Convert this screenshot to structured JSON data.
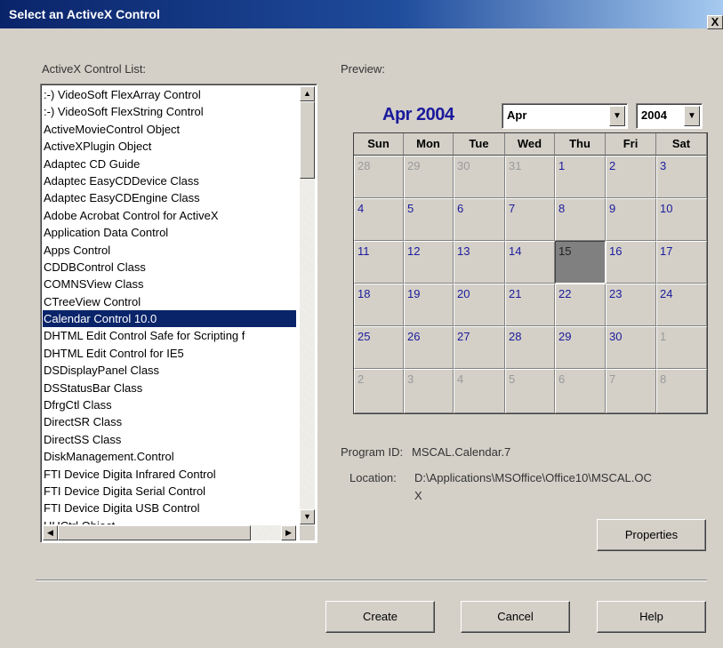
{
  "window": {
    "title": "Select an ActiveX Control",
    "close_label": "X"
  },
  "list": {
    "label": "ActiveX Control List:",
    "items": [
      ":-) VideoSoft FlexArray Control",
      ":-) VideoSoft FlexString Control",
      "ActiveMovieControl Object",
      "ActiveXPlugin Object",
      "Adaptec CD Guide",
      "Adaptec EasyCDDevice Class",
      "Adaptec EasyCDEngine Class",
      "Adobe Acrobat Control for ActiveX",
      "Application Data Control",
      "Apps Control",
      "CDDBControl Class",
      "COMNSView Class",
      "CTreeView Control",
      "Calendar Control 10.0",
      "DHTML Edit Control Safe for Scripting f",
      "DHTML Edit Control for IE5",
      "DSDisplayPanel Class",
      "DSStatusBar Class",
      "DfrgCtl Class",
      "DirectSR Class",
      "DirectSS Class",
      "DiskManagement.Control",
      "FTI Device Digita Infrared Control",
      "FTI Device Digita Serial Control",
      "FTI Device Digita USB Control",
      "HHCtrl Object"
    ],
    "selected_index": 13
  },
  "preview": {
    "label": "Preview:",
    "calendar_title": "Apr 2004",
    "month_value": "Apr",
    "year_value": "2004",
    "day_names": [
      "Sun",
      "Mon",
      "Tue",
      "Wed",
      "Thu",
      "Fri",
      "Sat"
    ],
    "weeks": [
      [
        "28",
        "29",
        "30",
        "31",
        "1",
        "2",
        "3"
      ],
      [
        "4",
        "5",
        "6",
        "7",
        "8",
        "9",
        "10"
      ],
      [
        "11",
        "12",
        "13",
        "14",
        "15",
        "16",
        "17"
      ],
      [
        "18",
        "19",
        "20",
        "21",
        "22",
        "23",
        "24"
      ],
      [
        "25",
        "26",
        "27",
        "28",
        "29",
        "30",
        "1"
      ],
      [
        "2",
        "3",
        "4",
        "5",
        "6",
        "7",
        "8"
      ]
    ],
    "today": "15"
  },
  "info": {
    "program_id_label": "Program ID:",
    "program_id_value": "MSCAL.Calendar.7",
    "location_label": "Location:",
    "location_value_line1": "D:\\Applications\\MSOffice\\Office10\\MSCAL.OC",
    "location_value_line2": "X"
  },
  "buttons": {
    "properties": "Properties",
    "create": "Create",
    "cancel": "Cancel",
    "help": "Help"
  },
  "colors": {
    "title_bar": "#0a246a",
    "selection": "#0a246a",
    "calendar_day": "#1a1a9c",
    "dialog_bg": "#d4d0c8"
  }
}
